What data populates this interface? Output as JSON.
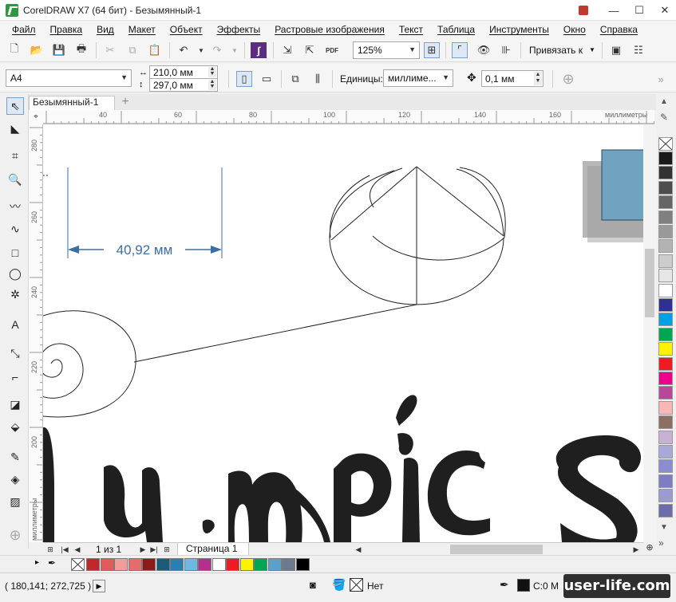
{
  "window": {
    "title": "CorelDRAW X7 (64 бит) - Безымянный-1"
  },
  "menu": [
    "Файл",
    "Правка",
    "Вид",
    "Макет",
    "Объект",
    "Эффекты",
    "Растровые изображения",
    "Текст",
    "Таблица",
    "Инструменты",
    "Окно",
    "Справка"
  ],
  "standard_toolbar": {
    "zoom": "125%",
    "snap_label": "Привязать к"
  },
  "property_bar": {
    "paper_size": "A4",
    "width": "210,0 мм",
    "height": "297,0 мм",
    "units_label": "Единицы:",
    "units_value": "миллиме...",
    "nudge": "0,1 мм"
  },
  "document_tab": "Безымянный-1",
  "rulers": {
    "h_labels": [
      "40",
      "60",
      "80",
      "100",
      "120",
      "140",
      "160"
    ],
    "h_unit": "миллиметры",
    "v_labels": [
      "280",
      "260",
      "240",
      "220",
      "200"
    ],
    "v_unit": "миллиметры"
  },
  "canvas": {
    "dimension_text": "40,92 мм",
    "artwork_text": "lumpics"
  },
  "page_nav": {
    "page_count": "1 из 1",
    "page_tab": "Страница 1"
  },
  "status": {
    "coords": "( 180,141; 272,725 )",
    "fill_label": "Нет",
    "outline_label": "C:0 M"
  },
  "watermark": "user-life.com",
  "colors": {
    "accent": "#2c9a3c",
    "dimension": "#3b6ea5",
    "rect_fill": "#6fa3bf",
    "palette_right": [
      "#1a1a1a",
      "#333333",
      "#4d4d4d",
      "#666666",
      "#808080",
      "#999999",
      "#b3b3b3",
      "#cccccc",
      "#e6e6e6",
      "#ffffff",
      "#2e3192",
      "#00a0e3",
      "#00a651",
      "#fff200",
      "#ed1c24",
      "#ec008c",
      "#b8479a",
      "#f6b7b6",
      "#8c6e63",
      "#c7b2d6",
      "#a9a9d8",
      "#8c8cd0",
      "#7d7dc4",
      "#9b9bd0",
      "#6c6ca8"
    ],
    "palette_bottom": [
      "#c1272d",
      "#e25b5b",
      "#f29c9c",
      "#e46c6c",
      "#8b1a1a",
      "#1b5b7a",
      "#2a7fb2",
      "#6fb8e0",
      "#b5308c",
      "#ffffff",
      "#ed1c24",
      "#fff200",
      "#00a651",
      "#5aa0c8",
      "#6b7a8f",
      "#000000"
    ]
  }
}
